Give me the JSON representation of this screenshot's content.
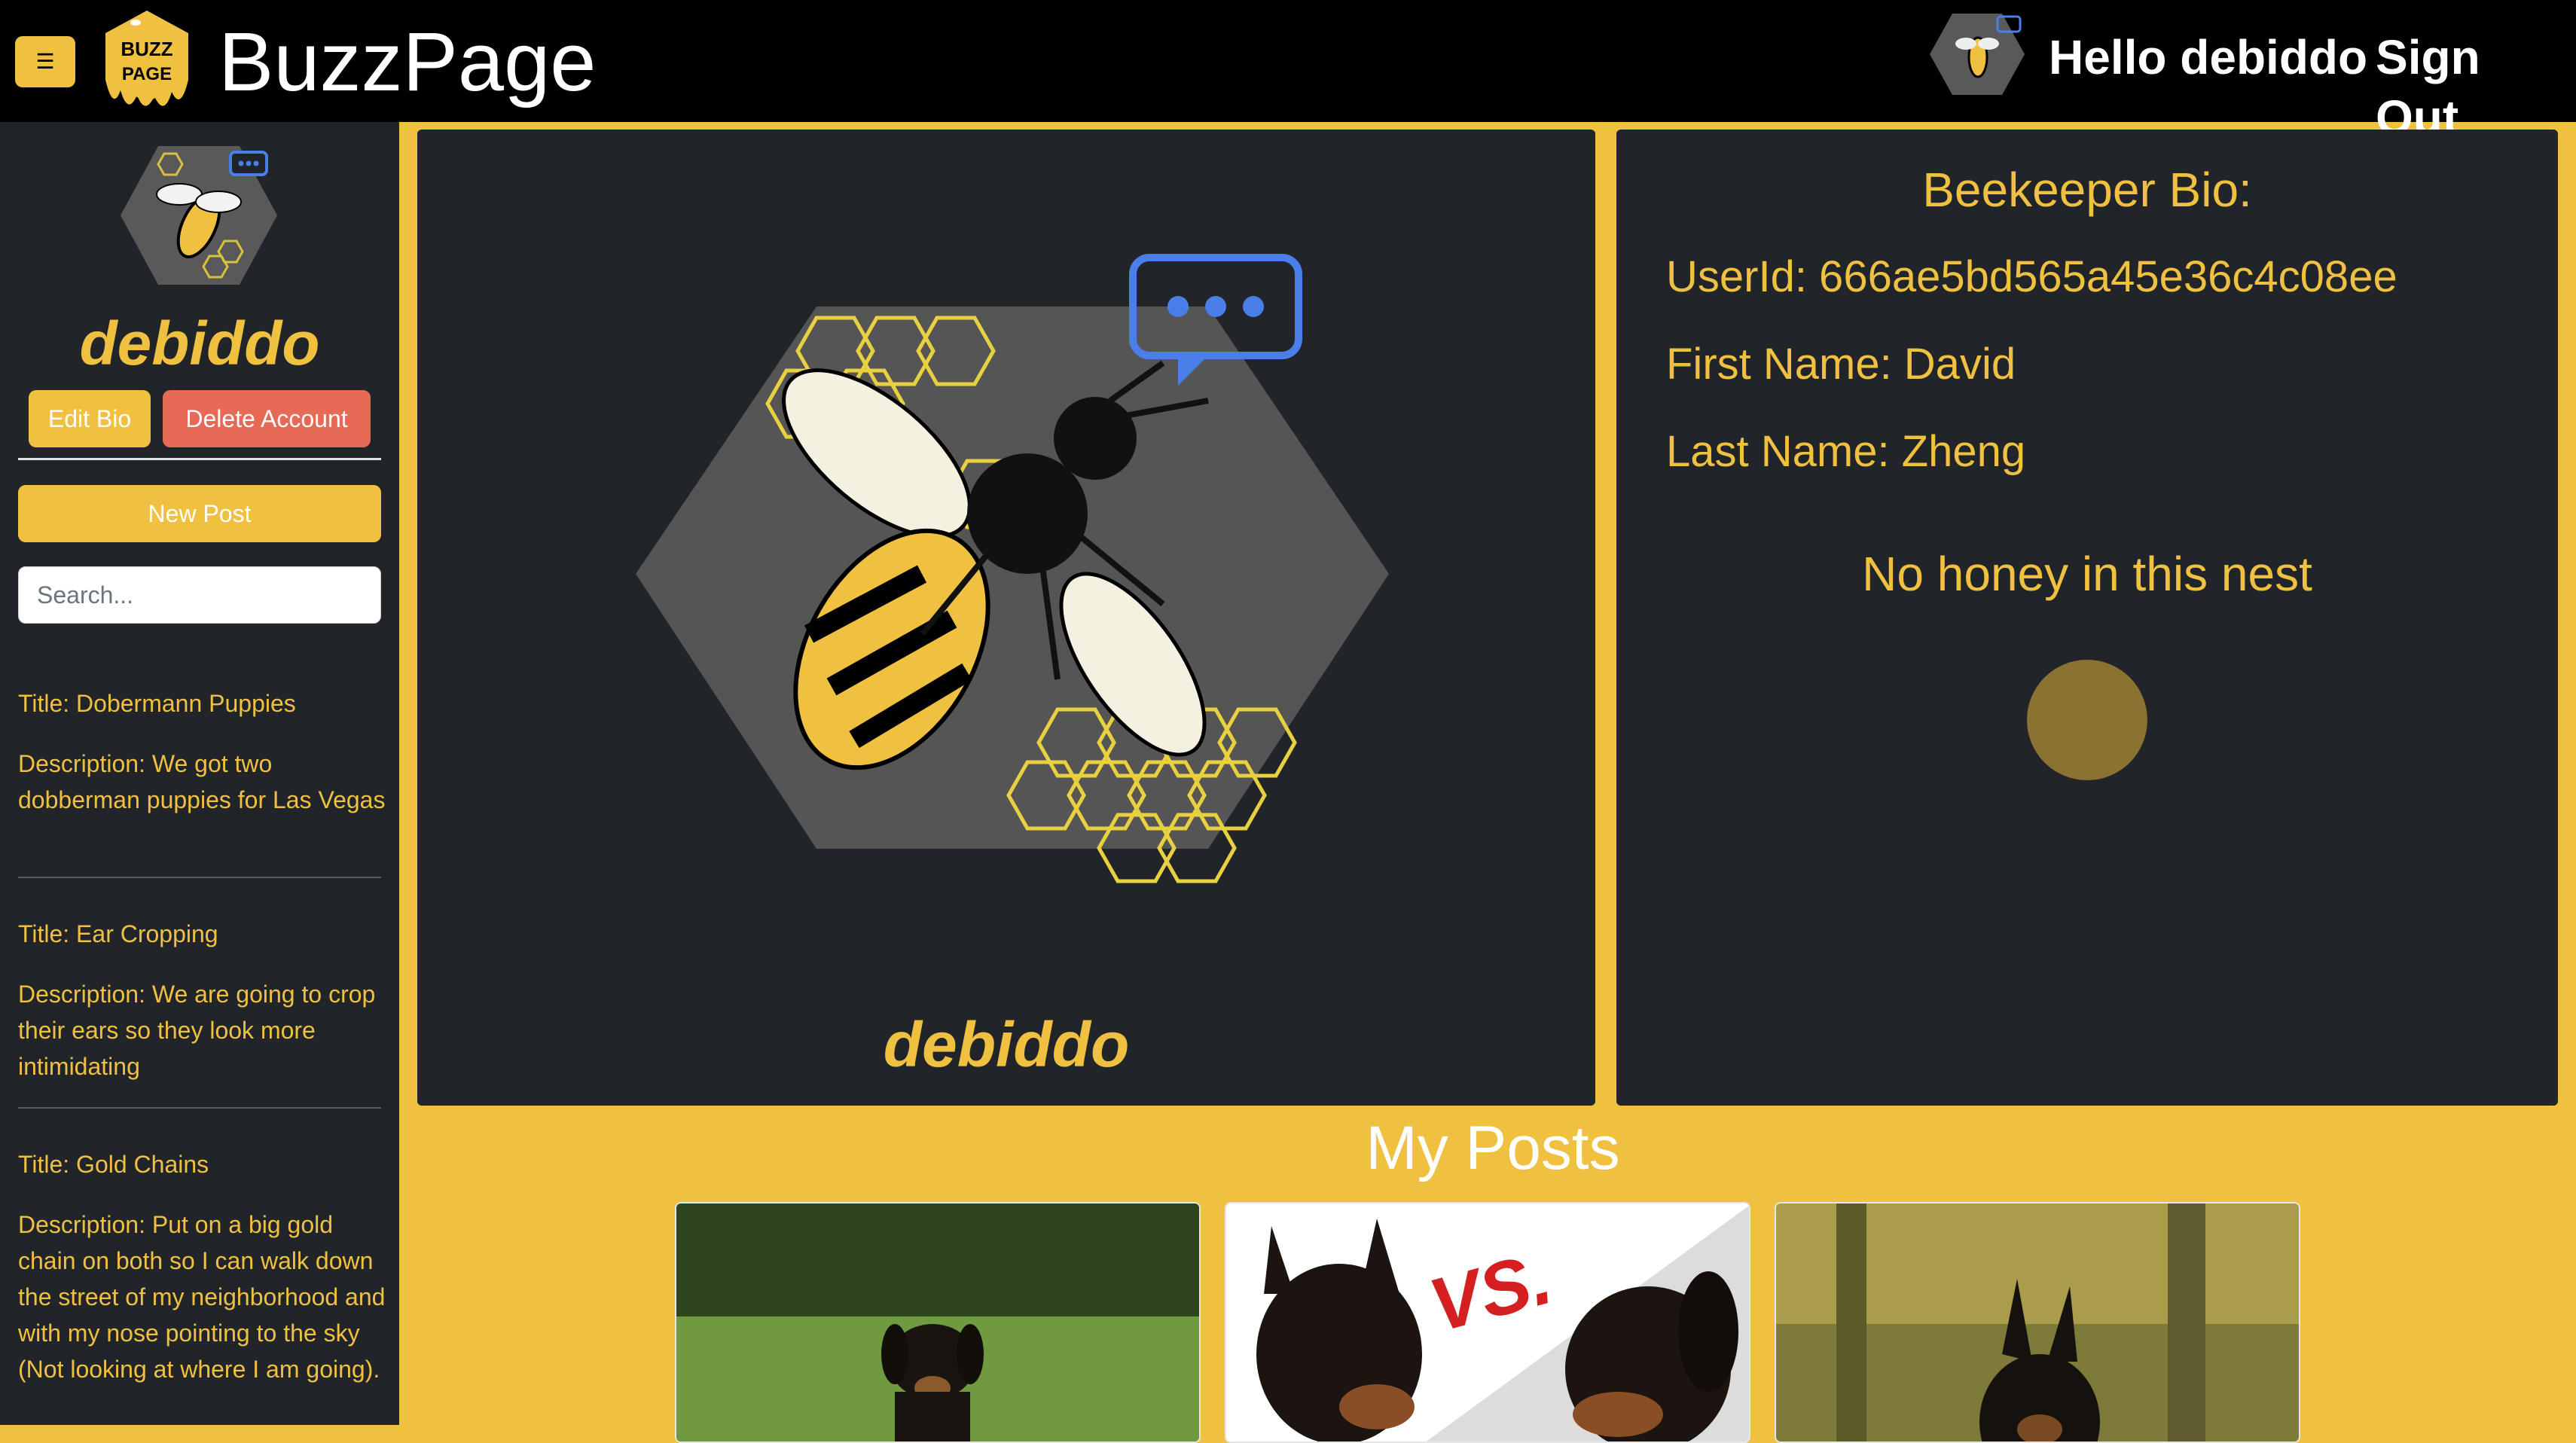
{
  "header": {
    "menu_icon": "☰",
    "brand": "BuzzPage",
    "greeting": "Hello debiddo",
    "sign_out": "Sign Out"
  },
  "logo": {
    "line1": "BUZZ",
    "line2": "PAGE"
  },
  "sidebar": {
    "username": "debiddo",
    "edit_bio": "Edit Bio",
    "delete_account": "Delete Account",
    "new_post": "New Post",
    "search_placeholder": "Search...",
    "posts": [
      {
        "title": "Title: Dobermann Puppies",
        "description": "Description: We got two dobberman puppies for Las Vegas"
      },
      {
        "title": "Title: Ear Cropping",
        "description": "Description: We are going to crop their ears so they look more intimidating"
      },
      {
        "title": "Title: Gold Chains",
        "description": "Description: Put on a big gold chain on both so I can walk down the street of my neighborhood and with my nose pointing to the sky (Not looking at where I am going)."
      }
    ]
  },
  "profile": {
    "username": "debiddo"
  },
  "bio": {
    "heading": "Beekeeper Bio:",
    "user_id": "UserId: 666ae5bd565a45e36c4c08ee",
    "first_name": "First Name: David",
    "last_name": "Last Name: Zheng",
    "empty_message": "No honey in this nest"
  },
  "my_posts": {
    "heading": "My Posts",
    "cards": [
      {
        "image": "dobermann-puppy-photo"
      },
      {
        "image": "dobermann-vs-photo",
        "overlay_text": "VS."
      },
      {
        "image": "dobermann-cropped-ears-photo"
      }
    ]
  },
  "colors": {
    "accent": "#f0c040",
    "panel": "#212529",
    "danger": "#e66a55",
    "chat_bubble": "#4a7ee8"
  }
}
